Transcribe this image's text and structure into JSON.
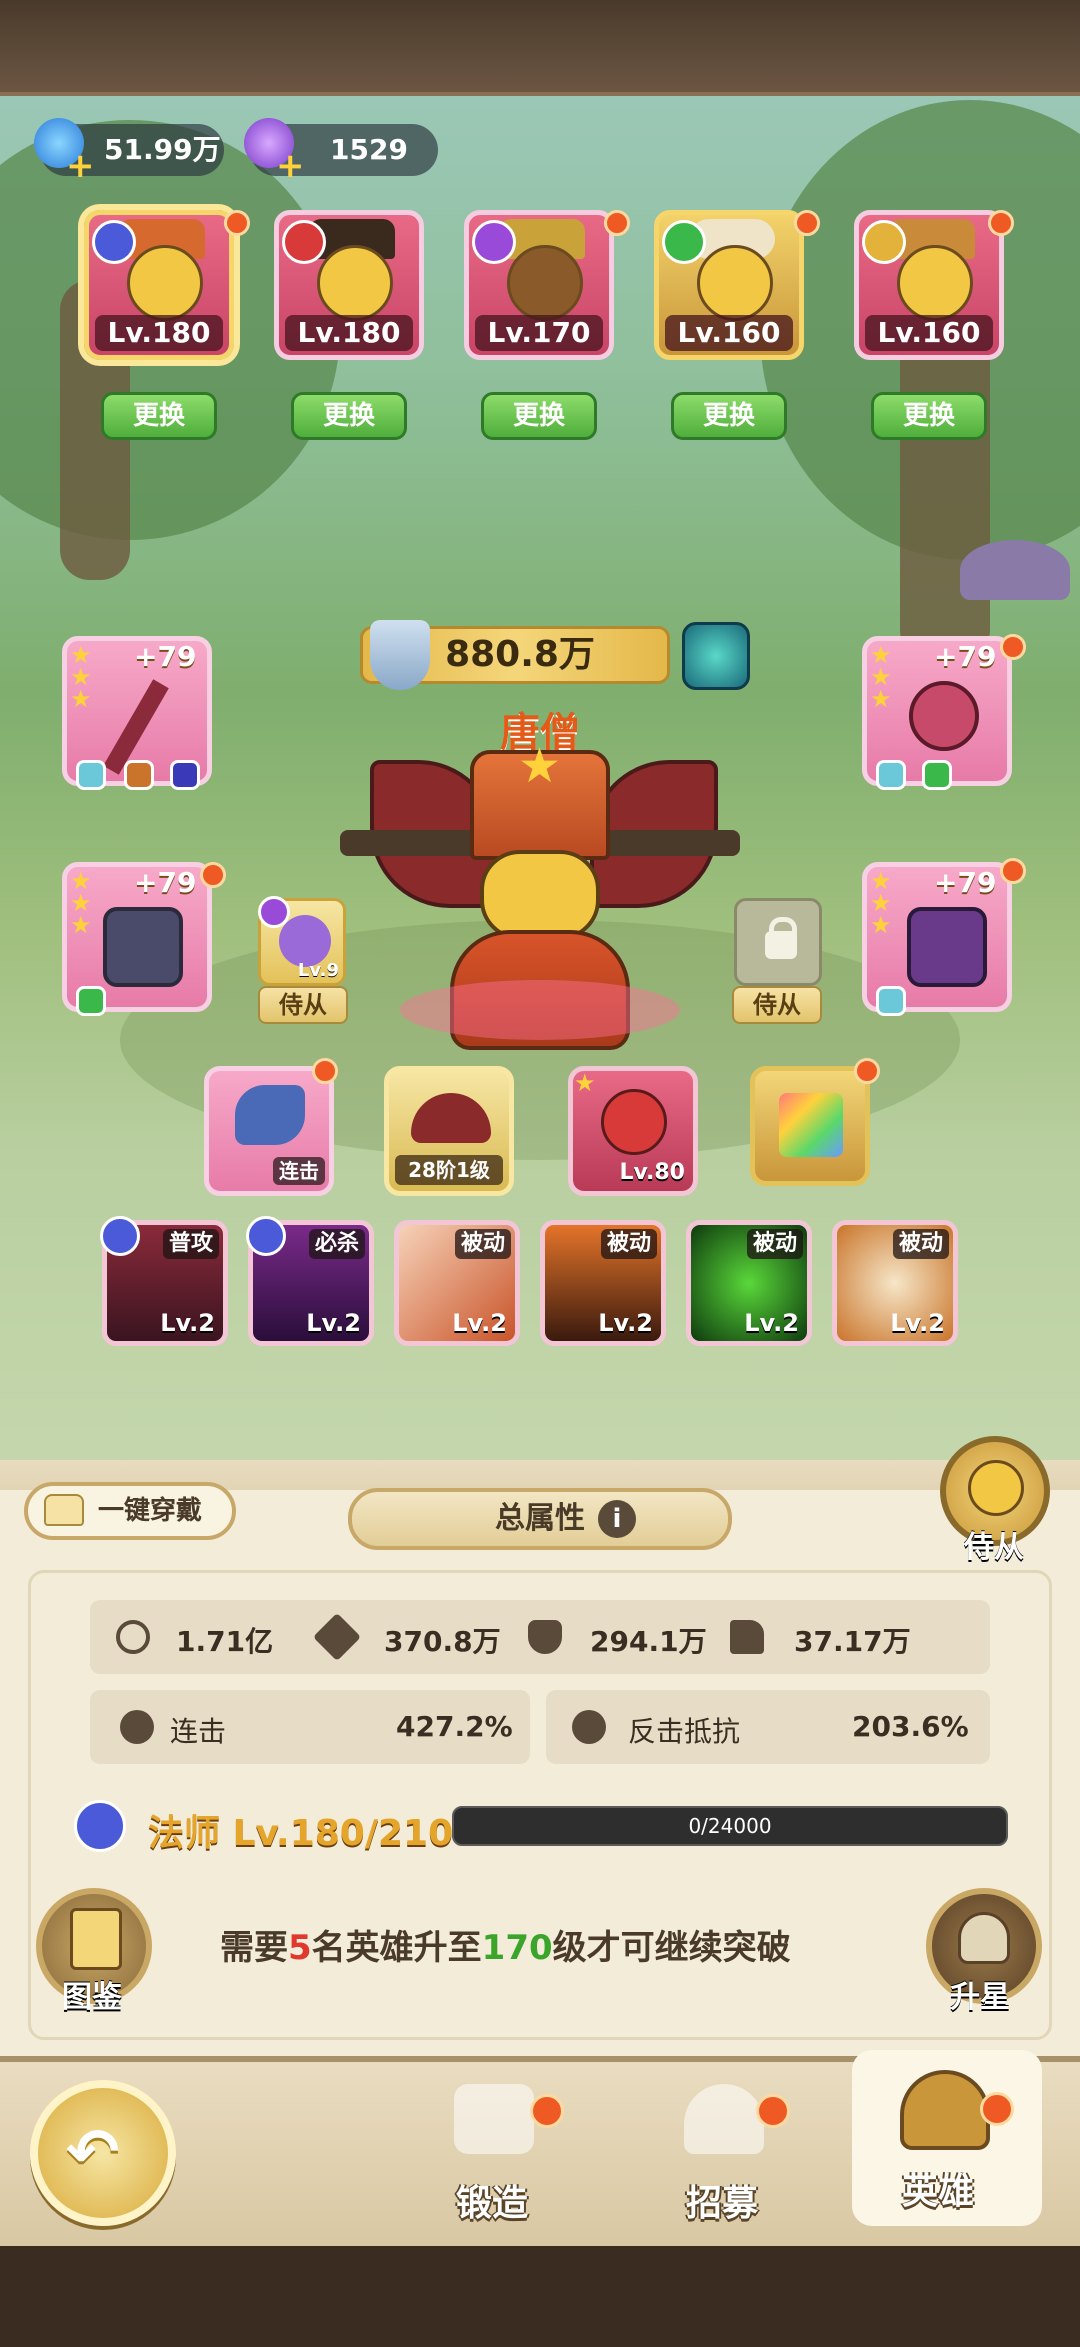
{
  "currency": {
    "crystal_value": "51.99万",
    "gem_value": "1529"
  },
  "team": [
    {
      "level": "Lv.180",
      "role": "mage",
      "swap_label": "更换",
      "selected": true
    },
    {
      "level": "Lv.180",
      "role": "warrior",
      "swap_label": "更换",
      "selected": false
    },
    {
      "level": "Lv.170",
      "role": "assassin",
      "swap_label": "更换",
      "selected": false
    },
    {
      "level": "Lv.160",
      "role": "support",
      "swap_label": "更换",
      "selected": false
    },
    {
      "level": "Lv.160",
      "role": "tank",
      "swap_label": "更换",
      "selected": false
    }
  ],
  "hero": {
    "power": "880.8万",
    "name": "唐僧"
  },
  "equipment": {
    "left_top": "+79",
    "right_top": "+79",
    "left_mid": "+79",
    "right_mid": "+79"
  },
  "followers": {
    "left_level": "Lv.9",
    "left_label": "侍从",
    "right_label": "侍从"
  },
  "gear_row": {
    "combo_label": "连击",
    "wings_label": "28阶1级",
    "pet_level": "Lv.80"
  },
  "skills": [
    {
      "tag": "普攻",
      "level": "Lv.2"
    },
    {
      "tag": "必杀",
      "level": "Lv.2"
    },
    {
      "tag": "被动",
      "level": "Lv.2"
    },
    {
      "tag": "被动",
      "level": "Lv.2"
    },
    {
      "tag": "被动",
      "level": "Lv.2"
    },
    {
      "tag": "被动",
      "level": "Lv.2"
    }
  ],
  "panel": {
    "one_key_equip": "一键穿戴",
    "total_attr": "总属性",
    "follower_btn": "侍从",
    "stats": {
      "hp": "1.71亿",
      "atk": "370.8万",
      "def": "294.1万",
      "spd": "37.17万",
      "combo_label": "连击",
      "combo_value": "427.2%",
      "counter_label": "反击抵抗",
      "counter_value": "203.6%"
    },
    "class_name": "法师",
    "class_level": "Lv.180/210",
    "xp": "0/24000",
    "requirement_a": "需要",
    "requirement_count": "5",
    "requirement_b": "名英雄升至",
    "requirement_level": "170",
    "requirement_c": "级才可继续突破",
    "codex_label": "图鉴",
    "star_up_label": "升星"
  },
  "nav": {
    "forge": "锻造",
    "recruit": "招募",
    "hero": "英雄"
  },
  "colors": {
    "accent_orange": "#e45a18",
    "green_button": "#4fae3c",
    "red_dot": "#ef5a24",
    "count_red": "#e0382c",
    "level_green": "#3aa52a"
  }
}
